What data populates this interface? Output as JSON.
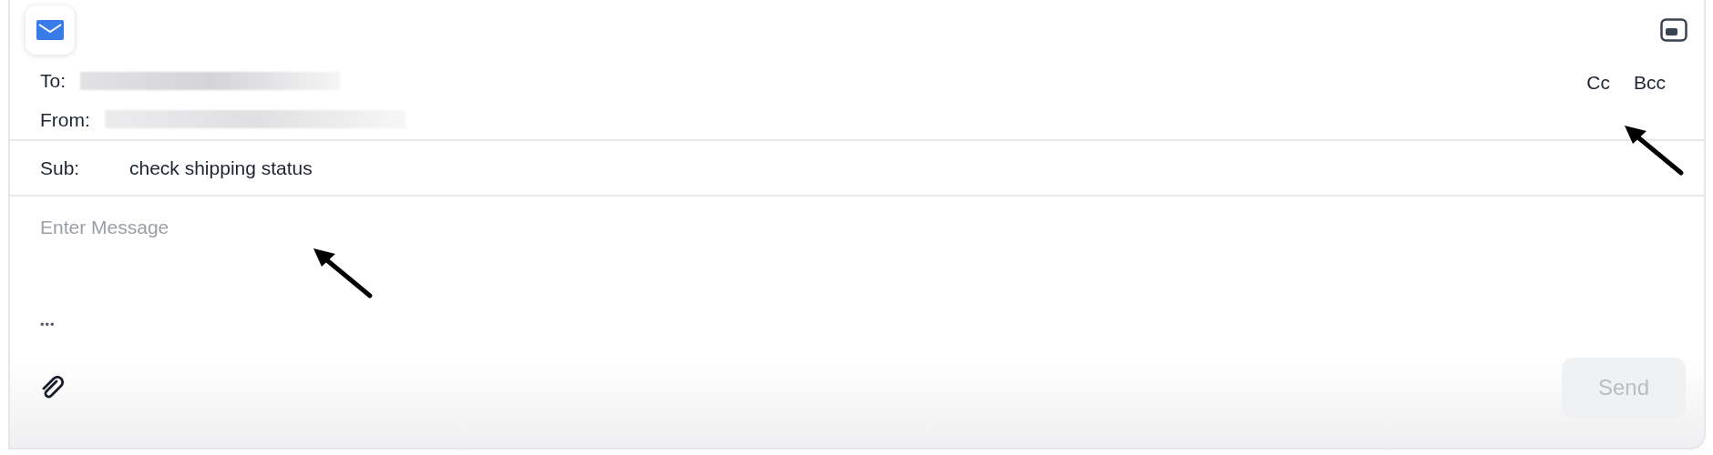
{
  "header": {
    "to_label": "To:",
    "from_label": "From:",
    "cc": "Cc",
    "bcc": "Bcc"
  },
  "subject": {
    "label": "Sub:",
    "value": "check shipping status"
  },
  "message": {
    "placeholder": "Enter Message"
  },
  "more": "•••",
  "send": {
    "label": "Send",
    "disabled": true
  }
}
